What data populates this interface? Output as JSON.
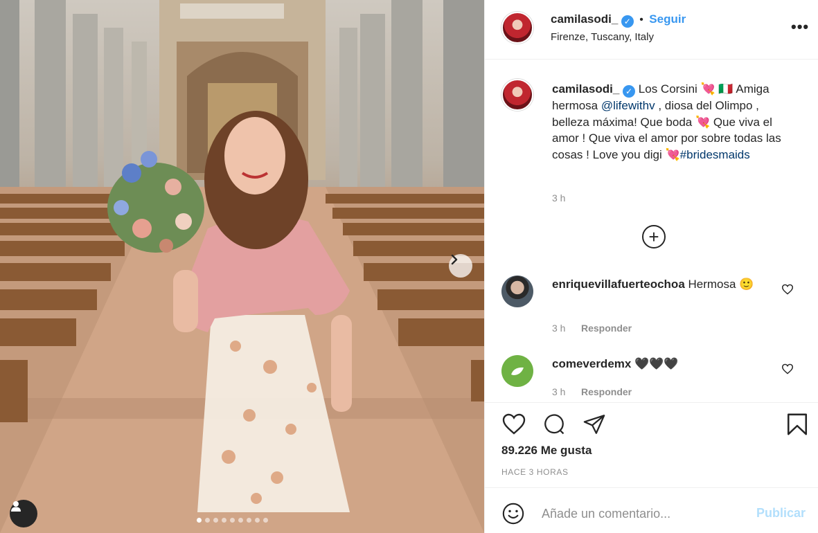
{
  "post": {
    "username": "camilasodi_",
    "follow_sep": "•",
    "follow_label": "Seguir",
    "location": "Firenze, Tuscany, Italy",
    "more": "•••"
  },
  "caption": {
    "username": "camilasodi_",
    "text_part1": " Los Corsini 💘 🇮🇹 Amiga hermosa ",
    "mention": "@lifewithv",
    "text_part2": " , diosa del Olimpo , belleza máxima! Que boda 💘 Que viva el amor ! Que viva el amor por sobre todas las cosas ! Love you digi 💘",
    "hashtag": "#bridesmaids",
    "time": "3 h"
  },
  "comments": [
    {
      "username": "enriquevillafuerteochoa",
      "text": " Hermosa 🙂",
      "time": "3 h",
      "reply": "Responder"
    },
    {
      "username": "comeverdemx",
      "text": " 🖤🖤🖤",
      "time": "3 h",
      "reply": "Responder"
    }
  ],
  "stats": {
    "likes": "89.226 Me gusta",
    "posted_ago": "HACE 3 HORAS"
  },
  "composer": {
    "placeholder": "Añade un comentario...",
    "publish_label": "Publicar"
  },
  "carousel": {
    "slides": 9,
    "active": 0
  },
  "colors": {
    "accent": "#3897f0",
    "link": "#00376b",
    "muted": "#8e8e8e",
    "publish_disabled": "#b2dffc"
  },
  "icons": [
    "verified-icon",
    "more-icon",
    "add-comments-icon",
    "heart-icon",
    "comment-icon",
    "share-icon",
    "bookmark-icon",
    "emoji-icon",
    "next-arrow-icon",
    "user-tag-icon"
  ]
}
